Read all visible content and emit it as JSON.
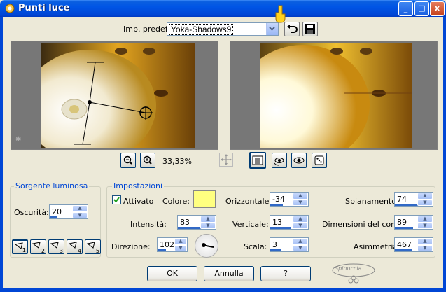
{
  "window": {
    "title": "Punti luce",
    "controls": {
      "minimize": "_",
      "maximize": "□",
      "close": "X"
    }
  },
  "preset": {
    "label": "Imp. predef.:",
    "value": "Yoka-Shadows9"
  },
  "zoom": {
    "value": "33,33%"
  },
  "light_source": {
    "group_label": "Sorgente luminosa",
    "darkness_label": "Oscurità:",
    "darkness_value": "20",
    "light_buttons": [
      "1",
      "2",
      "3",
      "4",
      "5"
    ]
  },
  "settings": {
    "group_label": "Impostazioni",
    "enabled_label": "Attivato",
    "enabled": true,
    "color_label": "Colore:",
    "color": "#ffff80",
    "intensity_label": "Intensità:",
    "intensity_value": "83",
    "direction_label": "Direzione:",
    "direction_value": "102",
    "horizontal_label": "Orizzontale:",
    "horizontal_value": "-34",
    "vertical_label": "Verticale:",
    "vertical_value": "13",
    "scale_label": "Scala:",
    "scale_value": "3",
    "smoothing_label": "Spianamento:",
    "smoothing_value": "74",
    "cone_label": "Dimensioni del cono:",
    "cone_value": "89",
    "asymmetry_label": "Asimmetria:",
    "asymmetry_value": "467"
  },
  "buttons": {
    "ok": "OK",
    "cancel": "Annulla",
    "help": "?"
  },
  "watermark": "Spinuccia"
}
